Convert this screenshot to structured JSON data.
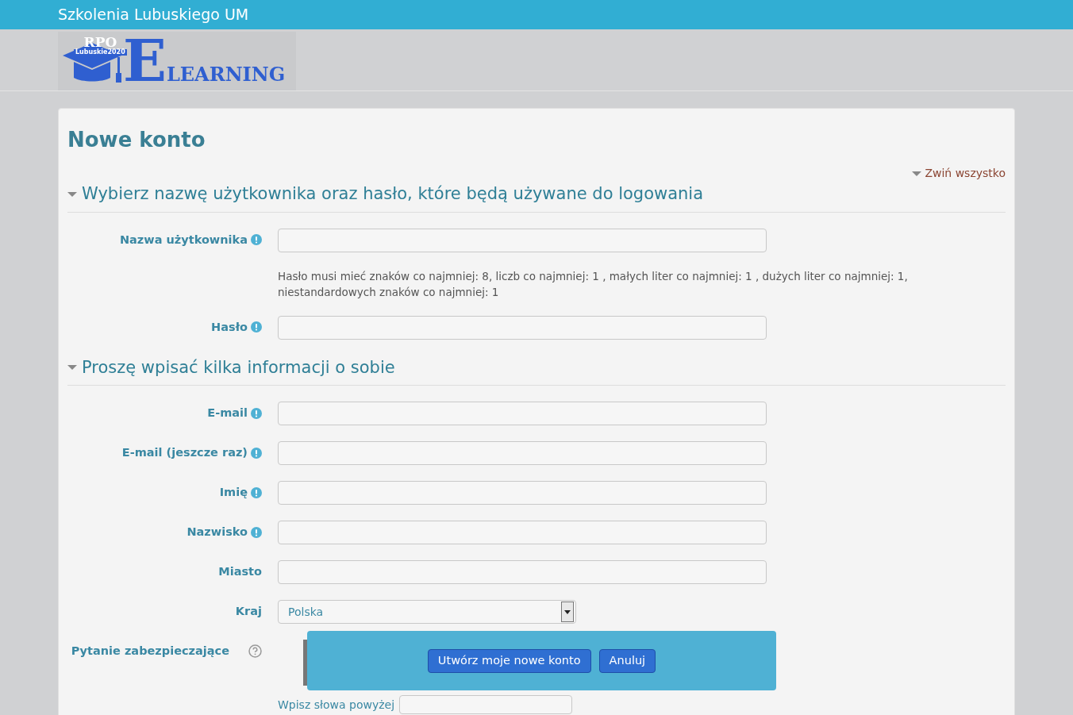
{
  "site_title": "Szkolenia Lubuskiego UM",
  "logo": {
    "badge": "RPO",
    "badge_sub": "Lubuskie2020",
    "letter": "E",
    "word": "LEARNING"
  },
  "page_title": "Nowe konto",
  "collapse_link": "Zwiń wszystko",
  "sections": [
    {
      "title": "Wybierz nazwę użytkownika oraz hasło, które będą używane do logowania",
      "expanded": true,
      "fields": [
        {
          "kind": "text",
          "label": "Nazwa użytkownika",
          "required": true,
          "help": false
        },
        {
          "kind": "note",
          "text": "Hasło musi mieć znaków co najmniej: 8, liczb co najmniej: 1 , małych liter co najmniej: 1 , dużych liter co najmniej: 1, niestandardowych znaków co najmniej: 1"
        },
        {
          "kind": "text",
          "label": "Hasło",
          "required": true,
          "help": false
        }
      ]
    },
    {
      "title": "Proszę wpisać kilka informacji o sobie",
      "expanded": true,
      "fields": [
        {
          "kind": "text",
          "label": "E-mail",
          "required": true,
          "help": false
        },
        {
          "kind": "text",
          "label": "E-mail (jeszcze raz)",
          "required": true,
          "help": false
        },
        {
          "kind": "text",
          "label": "Imię",
          "required": true,
          "help": false
        },
        {
          "kind": "text",
          "label": "Nazwisko",
          "required": true,
          "help": false
        },
        {
          "kind": "text",
          "label": "Miasto",
          "required": false,
          "help": false
        },
        {
          "kind": "select",
          "label": "Kraj",
          "value": "Polska",
          "required": false,
          "help": false
        },
        {
          "kind": "captcha",
          "label": "Pytanie zabezpieczające",
          "required": false,
          "help": true,
          "prompt": "Wpisz słowa powyżej"
        }
      ]
    }
  ],
  "actions": [
    "Utwórz moje nowe konto",
    "Anuluj"
  ]
}
